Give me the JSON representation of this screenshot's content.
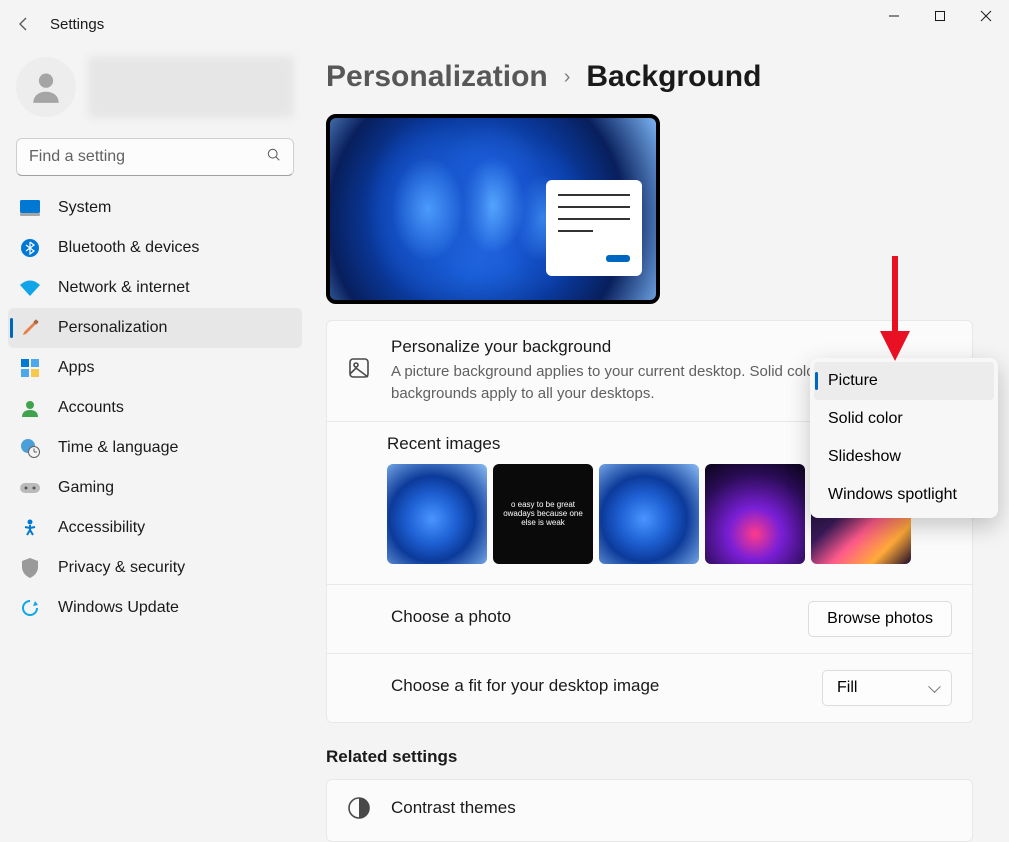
{
  "window": {
    "title": "Settings"
  },
  "search": {
    "placeholder": "Find a setting"
  },
  "nav": {
    "items": [
      {
        "label": "System"
      },
      {
        "label": "Bluetooth & devices"
      },
      {
        "label": "Network & internet"
      },
      {
        "label": "Personalization"
      },
      {
        "label": "Apps"
      },
      {
        "label": "Accounts"
      },
      {
        "label": "Time & language"
      },
      {
        "label": "Gaming"
      },
      {
        "label": "Accessibility"
      },
      {
        "label": "Privacy & security"
      },
      {
        "label": "Windows Update"
      }
    ]
  },
  "breadcrumb": {
    "parent": "Personalization",
    "current": "Background"
  },
  "bg": {
    "title": "Personalize your background",
    "desc": "A picture background applies to your current desktop. Solid color or slideshow backgrounds apply to all your desktops.",
    "recent_title": "Recent images",
    "thumb2_caption": "o easy to be great owadays because one else is weak",
    "choose_photo": "Choose a photo",
    "browse_label": "Browse photos",
    "fit_label": "Choose a fit for your desktop image",
    "fit_value": "Fill"
  },
  "flyout": {
    "opt0": "Picture",
    "opt1": "Solid color",
    "opt2": "Slideshow",
    "opt3": "Windows spotlight"
  },
  "related": {
    "header": "Related settings",
    "contrast": "Contrast themes"
  }
}
